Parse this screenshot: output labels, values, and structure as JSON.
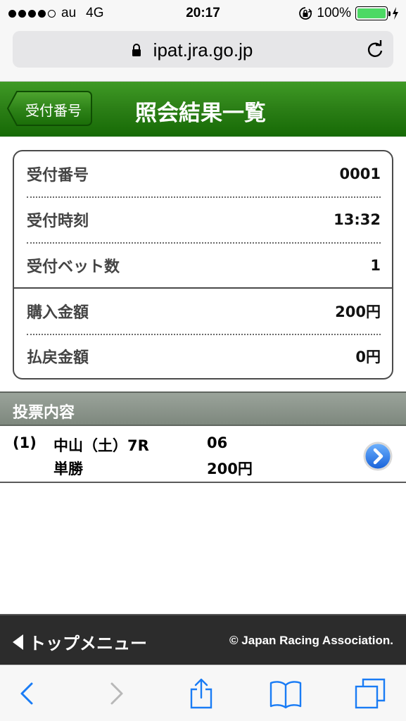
{
  "status_bar": {
    "carrier": "au",
    "network": "4G",
    "time": "20:17",
    "battery": "100%"
  },
  "browser": {
    "url": "ipat.jra.go.jp"
  },
  "header": {
    "back_label": "受付番号",
    "title": "照会結果一覧"
  },
  "summary": {
    "rows": [
      {
        "label": "受付番号",
        "value": "0001"
      },
      {
        "label": "受付時刻",
        "value": "13:32"
      },
      {
        "label": "受付ベット数",
        "value": "1"
      },
      {
        "label": "購入金額",
        "value": "200円"
      },
      {
        "label": "払戻金額",
        "value": "0円"
      }
    ]
  },
  "section": {
    "title": "投票内容"
  },
  "bets": [
    {
      "number": "(1)",
      "race": "中山（土）7R",
      "horse": "06",
      "type": "単勝",
      "amount": "200円"
    }
  ],
  "footer": {
    "top_menu": "トップメニュー",
    "copyright": "© Japan Racing Association."
  },
  "colors": {
    "header_green": "#2b7e16",
    "section_gray": "#8c958c",
    "battery_green": "#4cd964",
    "ios_blue": "#1a7cf5"
  }
}
